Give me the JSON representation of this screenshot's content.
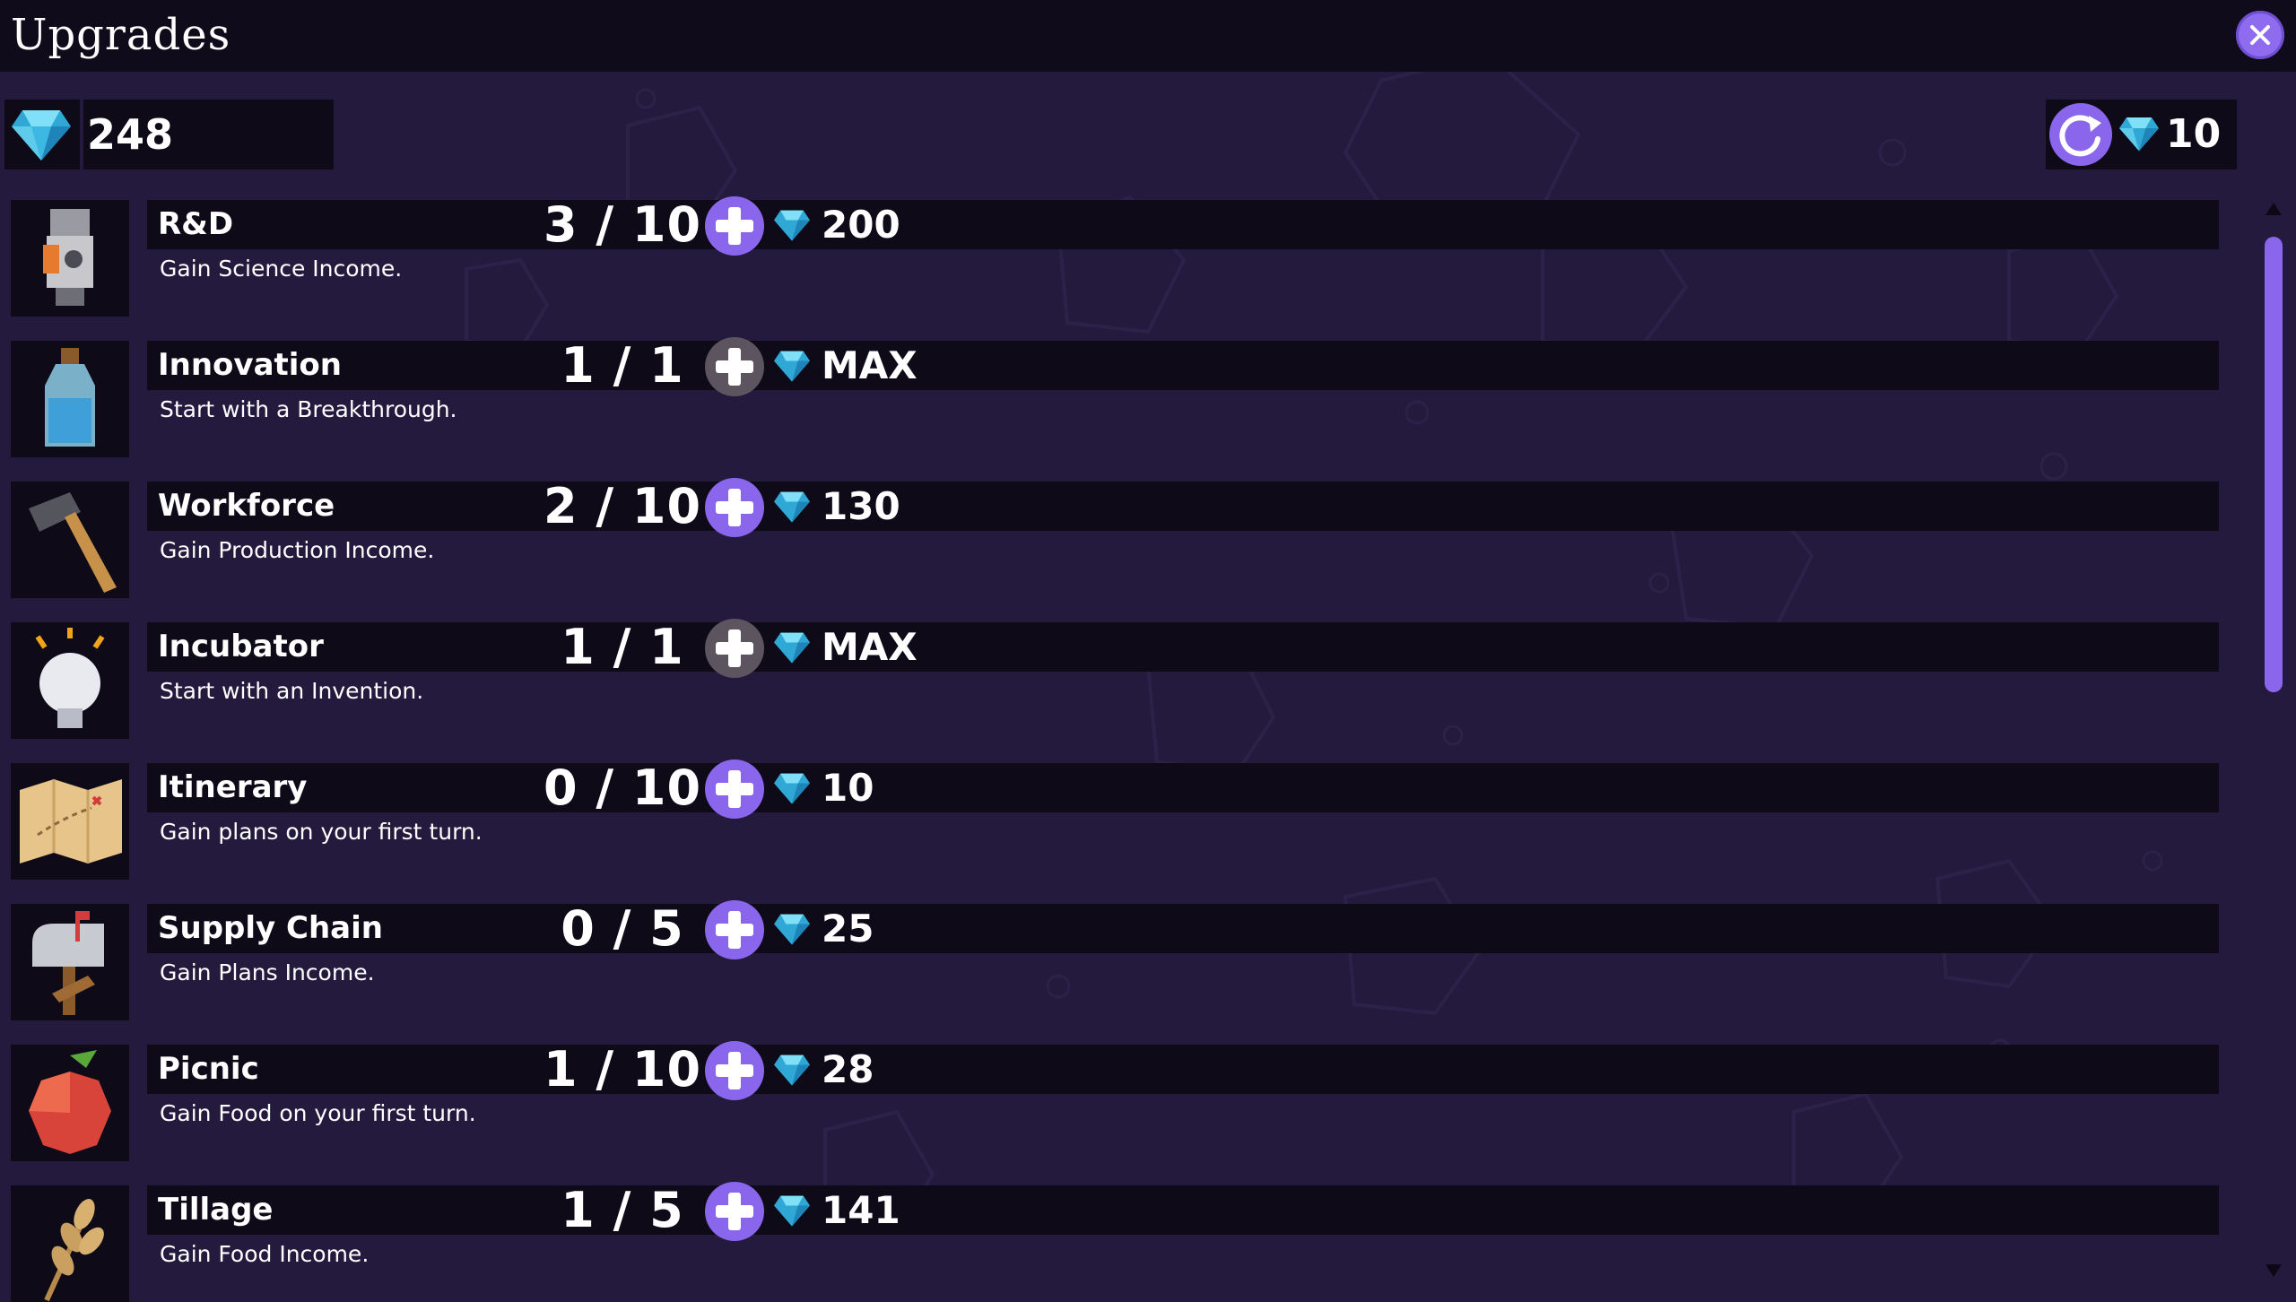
{
  "window": {
    "title": "Upgrades",
    "close_icon": "close-icon"
  },
  "currency": {
    "gems": "248",
    "gem_icon": "diamond-icon"
  },
  "reroll": {
    "icon": "refresh-icon",
    "cost": "10"
  },
  "colors": {
    "accent": "#8a66ec",
    "background": "#241a3e",
    "panel": "#0e0a18",
    "disabled": "#5c5560",
    "gem": "#3ec3e6"
  },
  "upgrades": [
    {
      "name": "R&D",
      "level": "3 / 10",
      "cost": "200",
      "desc": "Gain Science Income.",
      "icon": "lantern-icon",
      "maxed": false
    },
    {
      "name": "Innovation",
      "level": "1 / 1",
      "cost": "MAX",
      "desc": "Start with a Breakthrough.",
      "icon": "potion-bottle-icon",
      "maxed": true
    },
    {
      "name": "Workforce",
      "level": "2 / 10",
      "cost": "130",
      "desc": "Gain Production Income.",
      "icon": "hammer-icon",
      "maxed": false
    },
    {
      "name": "Incubator",
      "level": "1 / 1",
      "cost": "MAX",
      "desc": "Start with an Invention.",
      "icon": "lightbulb-icon",
      "maxed": true
    },
    {
      "name": "Itinerary",
      "level": "0 / 10",
      "cost": "10",
      "desc": "Gain plans on your first turn.",
      "icon": "map-icon",
      "maxed": false
    },
    {
      "name": "Supply Chain",
      "level": "0 / 5",
      "cost": "25",
      "desc": "Gain Plans Income.",
      "icon": "mailbox-icon",
      "maxed": false
    },
    {
      "name": "Picnic",
      "level": "1 / 10",
      "cost": "28",
      "desc": "Gain Food on your first turn.",
      "icon": "apple-icon",
      "maxed": false
    },
    {
      "name": "Tillage",
      "level": "1 / 5",
      "cost": "141",
      "desc": "Gain Food Income.",
      "icon": "wheat-icon",
      "maxed": false
    }
  ]
}
